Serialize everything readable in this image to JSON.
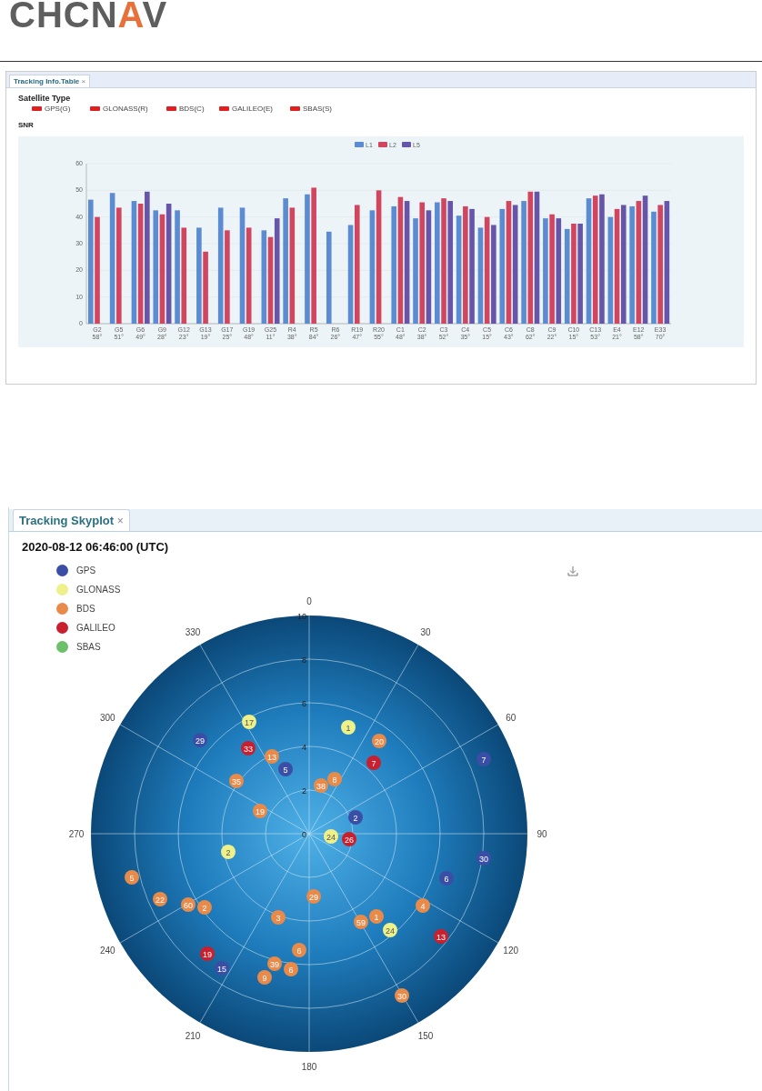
{
  "header": {
    "logo": {
      "parts": [
        {
          "text": "CHCN",
          "kind": "plain"
        },
        {
          "text": "A",
          "kind": "accent"
        },
        {
          "text": "V",
          "kind": "plain"
        }
      ]
    }
  },
  "info_table": {
    "tab": {
      "label": "Tracking Info.Table",
      "close": "×",
      "selected": true
    },
    "satellite_type_title": "Satellite Type",
    "satellite_types": [
      "GPS(G)",
      "GLONASS(R)",
      "BDS(C)",
      "GALILEO(E)",
      "SBAS(S)"
    ],
    "snr_title": "SNR",
    "chart_data": {
      "type": "bar",
      "grid": true,
      "legend": "top",
      "categories": [
        "G2 58°",
        "G5 51°",
        "G6 49°",
        "G9 28°",
        "G12 23°",
        "G13 19°",
        "G17 25°",
        "G19 48°",
        "G25 11°",
        "R4 38°",
        "R5 84°",
        "R6 26°",
        "R19 47°",
        "R20 55°",
        "C1 48°",
        "C2 38°",
        "C3 52°",
        "C4 35°",
        "C5 15°",
        "C6 43°",
        "C8 62°",
        "C9 22°",
        "C10 15°",
        "C13 53°",
        "E4 21°",
        "E12 58°",
        "E33 70°"
      ],
      "ylim": [
        0,
        60
      ],
      "yticks": [
        0,
        10,
        20,
        30,
        40,
        50,
        60
      ],
      "series": [
        {
          "name": "L1",
          "color": "#5b8bd0",
          "values": [
            46.5,
            49,
            46,
            42.5,
            42.5,
            36,
            43.5,
            43.5,
            35,
            47,
            48.5,
            34.5,
            37,
            42.5,
            44,
            39.5,
            45.5,
            40.5,
            36,
            43,
            46,
            39.5,
            35.5,
            47,
            40,
            44,
            42
          ]
        },
        {
          "name": "L2",
          "color": "#d2455e",
          "values": [
            40,
            43.5,
            45,
            41,
            36,
            27,
            35,
            36,
            32.5,
            43.5,
            51,
            null,
            44.5,
            50,
            47.5,
            45.5,
            47,
            44,
            40,
            46,
            49.5,
            41,
            37.5,
            48,
            43,
            46,
            44.5
          ]
        },
        {
          "name": "L5",
          "color": "#6655a8",
          "values": [
            null,
            null,
            49.5,
            45,
            null,
            null,
            null,
            null,
            39.5,
            null,
            null,
            null,
            null,
            null,
            46,
            42.5,
            46,
            43,
            37,
            44.5,
            49.5,
            39.5,
            37.5,
            48.5,
            44.5,
            48,
            46
          ]
        }
      ]
    }
  },
  "skyplot": {
    "tab": {
      "label": "Tracking Skyplot",
      "close": "×",
      "selected": true
    },
    "timestamp": "2020-08-12 06:46:00 (UTC)",
    "legend": [
      {
        "label": "GPS",
        "color": "#3b4ea6"
      },
      {
        "label": "GLONASS",
        "color": "#eef08a"
      },
      {
        "label": "BDS",
        "color": "#e88a4a"
      },
      {
        "label": "GALILEO",
        "color": "#c8202e"
      },
      {
        "label": "SBAS",
        "color": "#6cc06c"
      }
    ],
    "azimuth_labels": [
      "0",
      "30",
      "60",
      "90",
      "120",
      "150",
      "180",
      "210",
      "240",
      "270",
      "300",
      "330"
    ],
    "elevation_labels": [
      "10",
      "8",
      "6",
      "4",
      "2",
      "0"
    ],
    "satellites": [
      {
        "label": "29",
        "color": "#3b4ea6"
      },
      {
        "label": "5",
        "color": "#3b4ea6"
      },
      {
        "label": "2",
        "color": "#3b4ea6"
      },
      {
        "label": "7",
        "color": "#3b4ea6"
      },
      {
        "label": "30",
        "color": "#3b4ea6"
      },
      {
        "label": "6",
        "color": "#3b4ea6"
      },
      {
        "label": "15",
        "color": "#3b4ea6"
      },
      {
        "label": "17",
        "color": "#eef08a"
      },
      {
        "label": "1",
        "color": "#eef08a"
      },
      {
        "label": "2",
        "color": "#eef08a"
      },
      {
        "label": "24",
        "color": "#eef08a"
      },
      {
        "label": "24",
        "color": "#eef08a"
      },
      {
        "label": "20",
        "color": "#e88a4a"
      },
      {
        "label": "13",
        "color": "#e88a4a"
      },
      {
        "label": "8",
        "color": "#e88a4a"
      },
      {
        "label": "38",
        "color": "#e88a4a"
      },
      {
        "label": "35",
        "color": "#e88a4a"
      },
      {
        "label": "19",
        "color": "#e88a4a"
      },
      {
        "label": "5",
        "color": "#e88a4a"
      },
      {
        "label": "22",
        "color": "#e88a4a"
      },
      {
        "label": "60",
        "color": "#e88a4a"
      },
      {
        "label": "2",
        "color": "#e88a4a"
      },
      {
        "label": "29",
        "color": "#e88a4a"
      },
      {
        "label": "3",
        "color": "#e88a4a"
      },
      {
        "label": "6",
        "color": "#e88a4a"
      },
      {
        "label": "39",
        "color": "#e88a4a"
      },
      {
        "label": "6",
        "color": "#e88a4a"
      },
      {
        "label": "59",
        "color": "#e88a4a"
      },
      {
        "label": "1",
        "color": "#e88a4a"
      },
      {
        "label": "4",
        "color": "#e88a4a"
      },
      {
        "label": "9",
        "color": "#e88a4a"
      },
      {
        "label": "30",
        "color": "#e88a4a"
      },
      {
        "label": "33",
        "color": "#c8202e"
      },
      {
        "label": "7",
        "color": "#c8202e"
      },
      {
        "label": "26",
        "color": "#c8202e"
      },
      {
        "label": "13",
        "color": "#c8202e"
      },
      {
        "label": "19",
        "color": "#c8202e"
      }
    ]
  }
}
